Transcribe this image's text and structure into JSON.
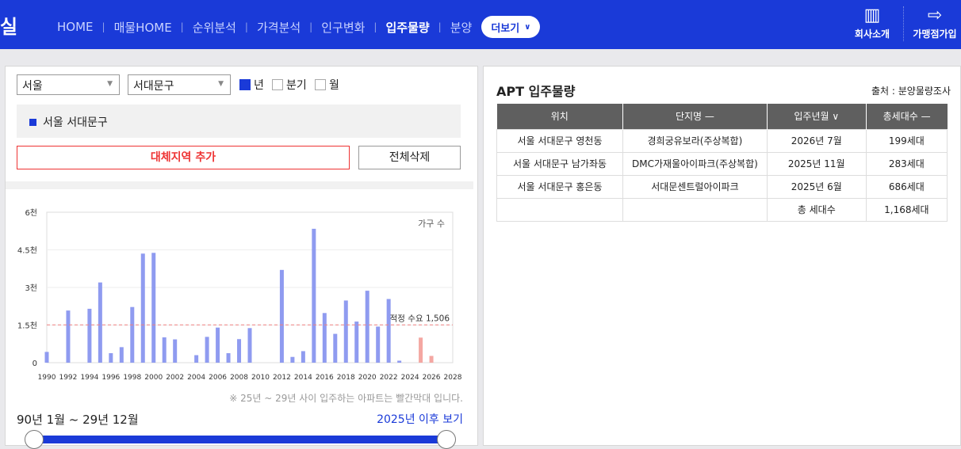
{
  "header": {
    "logo": "실",
    "nav": [
      {
        "label": "HOME",
        "active": false
      },
      {
        "label": "매물HOME",
        "active": false
      },
      {
        "label": "순위분석",
        "active": false
      },
      {
        "label": "가격분석",
        "active": false
      },
      {
        "label": "인구변화",
        "active": false
      },
      {
        "label": "입주물량",
        "active": true
      },
      {
        "label": "분양",
        "active": false
      }
    ],
    "more_label": "더보기",
    "company_label": "회사소개",
    "franchise_label": "가맹점가입"
  },
  "filters": {
    "city": "서울",
    "district": "서대문구",
    "period_options": [
      {
        "label": "년",
        "checked": true
      },
      {
        "label": "분기",
        "checked": false
      },
      {
        "label": "월",
        "checked": false
      }
    ]
  },
  "region_selected": "서울 서대문구",
  "add_region_label": "대체지역 추가",
  "delete_all_label": "전체삭제",
  "chart_data": {
    "type": "bar",
    "unit_label": "가구 수",
    "y_ticks": [
      "0",
      "1.5천",
      "3천",
      "4.5천",
      "6천"
    ],
    "ylim": [
      0,
      6000
    ],
    "x_ticks": [
      "1990",
      "1992",
      "1994",
      "1996",
      "1998",
      "2000",
      "2002",
      "2004",
      "2006",
      "2008",
      "2010",
      "2012",
      "2014",
      "2016",
      "2018",
      "2020",
      "2022",
      "2024",
      "2026",
      "2028"
    ],
    "xlim": [
      1990,
      2028
    ],
    "demand_line": {
      "label": "적정 수요 1,506",
      "value": 1506
    },
    "highlight_from_year": 2025,
    "colors": {
      "normal": "#8f9bf0",
      "future": "#f4a7a2",
      "demand_line": "#f08080"
    },
    "years": [
      1990,
      1992,
      1994,
      1995,
      1996,
      1997,
      1998,
      1999,
      2000,
      2001,
      2002,
      2004,
      2005,
      2006,
      2007,
      2008,
      2009,
      2012,
      2013,
      2014,
      2015,
      2016,
      2017,
      2018,
      2019,
      2020,
      2021,
      2022,
      2023,
      2025,
      2026
    ],
    "values": [
      430,
      2080,
      2150,
      3200,
      380,
      620,
      2220,
      4350,
      4380,
      1010,
      930,
      300,
      1030,
      1400,
      380,
      940,
      1380,
      3700,
      230,
      460,
      5340,
      1980,
      1150,
      2480,
      1640,
      2870,
      1440,
      2540,
      80,
      1000,
      270
    ]
  },
  "note": "※ 25년 ~ 29년 사이 입주하는 아파트는 빨간막대 입니다.",
  "range_label": "90년 1월 ~ 29년 12월",
  "after_link": "2025년 이후 보기",
  "slider": {
    "start": 0,
    "end": 1
  },
  "apt_panel": {
    "title": "APT 입주물량",
    "source": "출처 : 분양물량조사",
    "columns": [
      "위치",
      "단지명 —",
      "입주년월 ∨",
      "총세대수 —"
    ],
    "rows": [
      [
        "서울 서대문구 영천동",
        "경희궁유보라(주상복합)",
        "2026년 7월",
        "199세대"
      ],
      [
        "서울 서대문구 남가좌동",
        "DMC가재울아이파크(주상복합)",
        "2025년 11월",
        "283세대"
      ],
      [
        "서울 서대문구 홍은동",
        "서대문센트럴아이파크",
        "2025년 6월",
        "686세대"
      ]
    ],
    "total_label": "총 세대수",
    "total_value": "1,168세대"
  }
}
